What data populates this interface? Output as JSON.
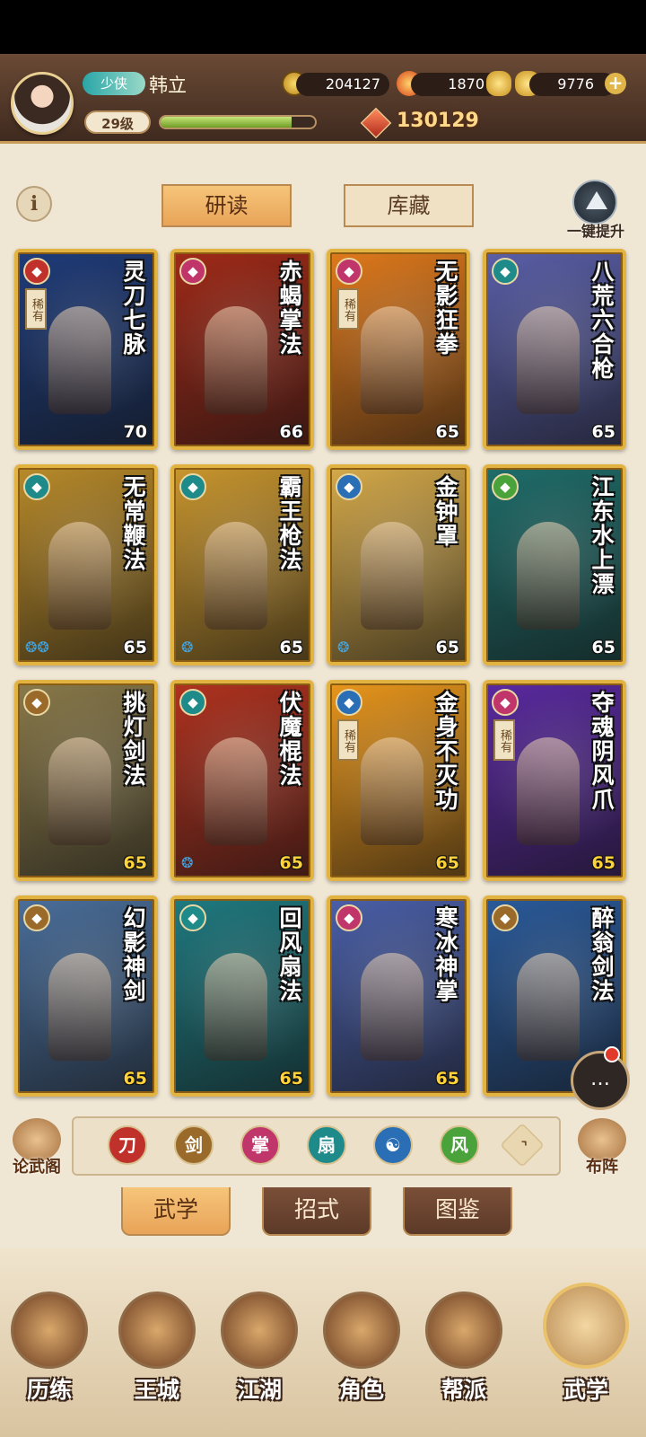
{
  "player": {
    "title": "少侠",
    "name": "韩立",
    "level": "29级",
    "exp_fraction": 0.85,
    "combat_power": "130129"
  },
  "resources": {
    "coins": "204127",
    "fire": "1870",
    "gold": "9776"
  },
  "tabs": [
    {
      "label": "研读",
      "active": true
    },
    {
      "label": "库藏",
      "active": false
    }
  ],
  "upgrade_all_label": "一键提升",
  "cards": [
    {
      "title": "灵刀七脉",
      "level": "70",
      "rare": "稀有",
      "type_icon": "blade-icon",
      "type_color": "#c0312b",
      "bg": "#1f3c7a",
      "gold_level": false
    },
    {
      "title": "赤蝎掌法",
      "level": "66",
      "rare": "",
      "type_icon": "palm-icon",
      "type_color": "#c0366b",
      "bg": "#a02a18",
      "gold_level": false
    },
    {
      "title": "无影狂拳",
      "level": "65",
      "rare": "稀有",
      "type_icon": "fist-icon",
      "type_color": "#c0366b",
      "bg": "#e07a1c",
      "gold_level": false
    },
    {
      "title": "八荒六合枪",
      "level": "65",
      "rare": "",
      "type_icon": "spear-icon",
      "type_color": "#1f8a8a",
      "bg": "#5a5fa8",
      "gold_level": false
    },
    {
      "title": "无常鞭法",
      "level": "65",
      "rare": "",
      "type_icon": "whip-icon",
      "type_color": "#1f8a8a",
      "bg": "#b88a2a",
      "gold_level": false,
      "stars": "❂❂"
    },
    {
      "title": "霸王枪法",
      "level": "65",
      "rare": "",
      "type_icon": "spear-icon",
      "type_color": "#1f8a8a",
      "bg": "#c9962e",
      "gold_level": false,
      "stars": "❂"
    },
    {
      "title": "金钟罩",
      "level": "65",
      "rare": "",
      "type_icon": "yinyang-icon",
      "type_color": "#2a6fb5",
      "bg": "#d4a94a",
      "gold_level": false,
      "stars": "❂"
    },
    {
      "title": "江东水上漂",
      "level": "65",
      "rare": "",
      "type_icon": "wind-icon",
      "type_color": "#4aa33a",
      "bg": "#1f6d6a",
      "gold_level": false
    },
    {
      "title": "挑灯剑法",
      "level": "65",
      "rare": "",
      "type_icon": "sword-icon",
      "type_color": "#9a6a2a",
      "bg": "#8a7a4a",
      "gold_level": true
    },
    {
      "title": "伏魔棍法",
      "level": "65",
      "rare": "",
      "type_icon": "staff-icon",
      "type_color": "#1f8a8a",
      "bg": "#b0321f",
      "gold_level": true,
      "stars": "❂"
    },
    {
      "title": "金身不灭功",
      "level": "65",
      "rare": "稀有",
      "type_icon": "yinyang-icon",
      "type_color": "#2a6fb5",
      "bg": "#e8961c",
      "gold_level": true
    },
    {
      "title": "夺魂阴风爪",
      "level": "65",
      "rare": "稀有",
      "type_icon": "claw-icon",
      "type_color": "#c0366b",
      "bg": "#5a2aa0",
      "gold_level": true
    },
    {
      "title": "幻影神剑",
      "level": "65",
      "rare": "",
      "type_icon": "sword-icon",
      "type_color": "#9a6a2a",
      "bg": "#4a6e9a",
      "gold_level": true
    },
    {
      "title": "回风扇法",
      "level": "65",
      "rare": "",
      "type_icon": "fan-icon",
      "type_color": "#1f8a8a",
      "bg": "#1f7a80",
      "gold_level": true
    },
    {
      "title": "寒冰神掌",
      "level": "65",
      "rare": "",
      "type_icon": "palm-icon",
      "type_color": "#c0366b",
      "bg": "#4a5fa8",
      "gold_level": true
    },
    {
      "title": "醉翁剑法",
      "level": "65",
      "rare": "",
      "type_icon": "sword-icon",
      "type_color": "#9a6a2a",
      "bg": "#2a5a9a",
      "gold_level": true
    }
  ],
  "filters": [
    {
      "name": "blade-filter-icon",
      "color": "#c0312b",
      "glyph": "刀"
    },
    {
      "name": "sword-filter-icon",
      "color": "#9a6a2a",
      "glyph": "剑"
    },
    {
      "name": "palm-filter-icon",
      "color": "#c0366b",
      "glyph": "掌"
    },
    {
      "name": "fan-filter-icon",
      "color": "#1f8a8a",
      "glyph": "扇"
    },
    {
      "name": "yinyang-filter-icon",
      "color": "#2a6fb5",
      "glyph": "☯"
    },
    {
      "name": "wind-filter-icon",
      "color": "#4aa33a",
      "glyph": "风"
    },
    {
      "name": "up-arrow-filter-icon",
      "color": "#e8d7b0",
      "glyph": "⌃"
    }
  ],
  "side_left_label": "论武阁",
  "side_right_label": "布阵",
  "subtabs": [
    {
      "label": "武学",
      "active": true
    },
    {
      "label": "招式",
      "active": false
    },
    {
      "label": "图鉴",
      "active": false
    }
  ],
  "nav": [
    {
      "label": "历练",
      "active": false
    },
    {
      "label": "王城",
      "active": false
    },
    {
      "label": "江湖",
      "active": false
    },
    {
      "label": "角色",
      "active": false
    },
    {
      "label": "帮派",
      "active": false
    },
    {
      "label": "武学",
      "active": true
    }
  ]
}
